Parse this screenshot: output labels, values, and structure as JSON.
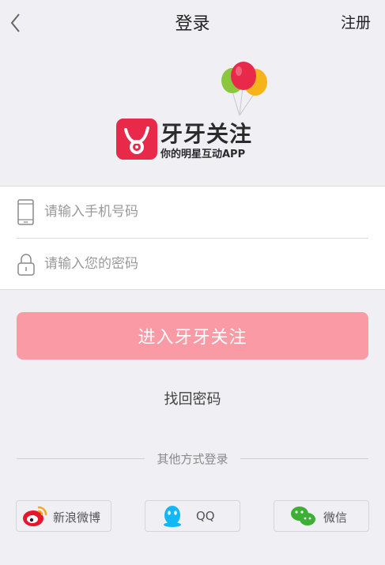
{
  "header": {
    "title": "登录",
    "register_label": "注册"
  },
  "brand": {
    "name": "牙牙关注",
    "slogan": "你的明星互动APP",
    "accent_color": "#e8294a"
  },
  "form": {
    "phone": {
      "placeholder": "请输入手机号码",
      "value": "",
      "icon": "phone-icon"
    },
    "password": {
      "placeholder": "请输入您的密码",
      "value": "",
      "icon": "lock-icon"
    }
  },
  "login_button": {
    "label": "进入牙牙关注",
    "color": "#f99aa5"
  },
  "forgot_label": "找回密码",
  "other_methods": {
    "label": "其他方式登录",
    "buttons": [
      {
        "label": "新浪微博",
        "icon": "weibo-icon",
        "color": "#e6162d"
      },
      {
        "label": "QQ",
        "icon": "qq-icon",
        "color": "#12b7f5"
      },
      {
        "label": "微信",
        "icon": "wechat-icon",
        "color": "#3cb034"
      }
    ]
  }
}
